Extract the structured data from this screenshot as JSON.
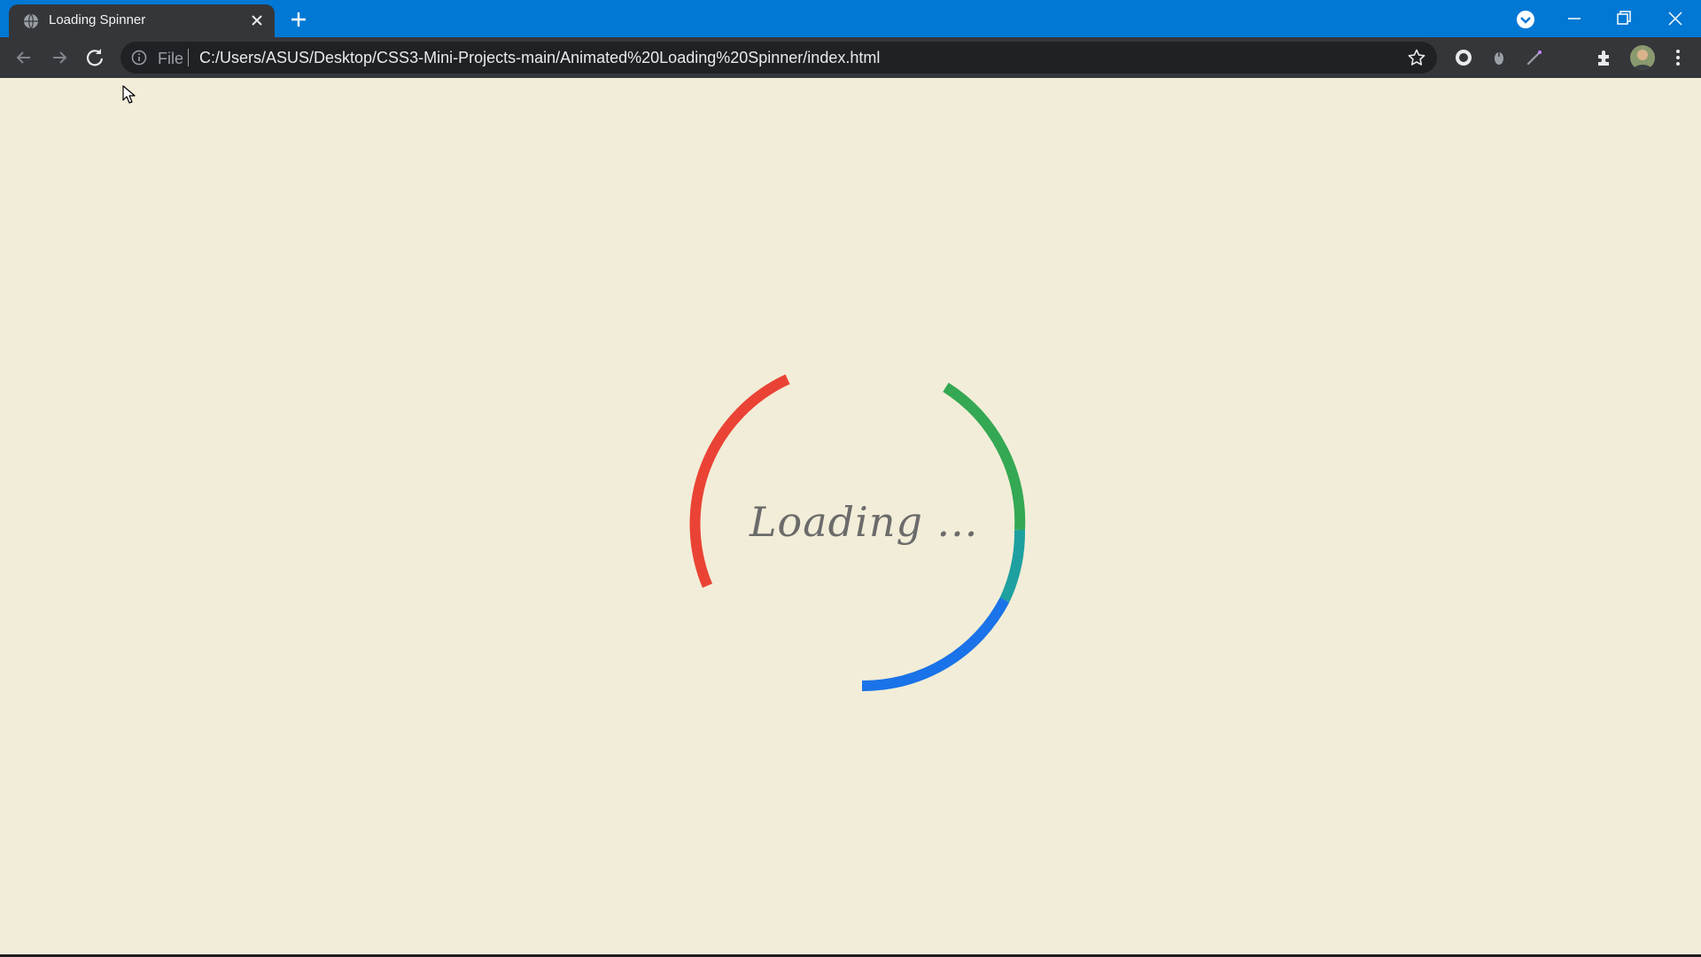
{
  "browser": {
    "tab": {
      "title": "Loading Spinner",
      "favicon": "globe-icon"
    },
    "address_bar": {
      "scheme_label": "File",
      "url": "C:/Users/ASUS/Desktop/CSS3-Mini-Projects-main/Animated%20Loading%20Spinner/index.html"
    },
    "colors": {
      "tab_strip": "#0078d4",
      "toolbar": "#35363a",
      "omnibox": "#202124"
    }
  },
  "page": {
    "background": "#f2edd8",
    "loading_text": "Loading ...",
    "spinner": {
      "colors": [
        "#ea4335",
        "#34a853",
        "#1a73e8"
      ]
    }
  }
}
